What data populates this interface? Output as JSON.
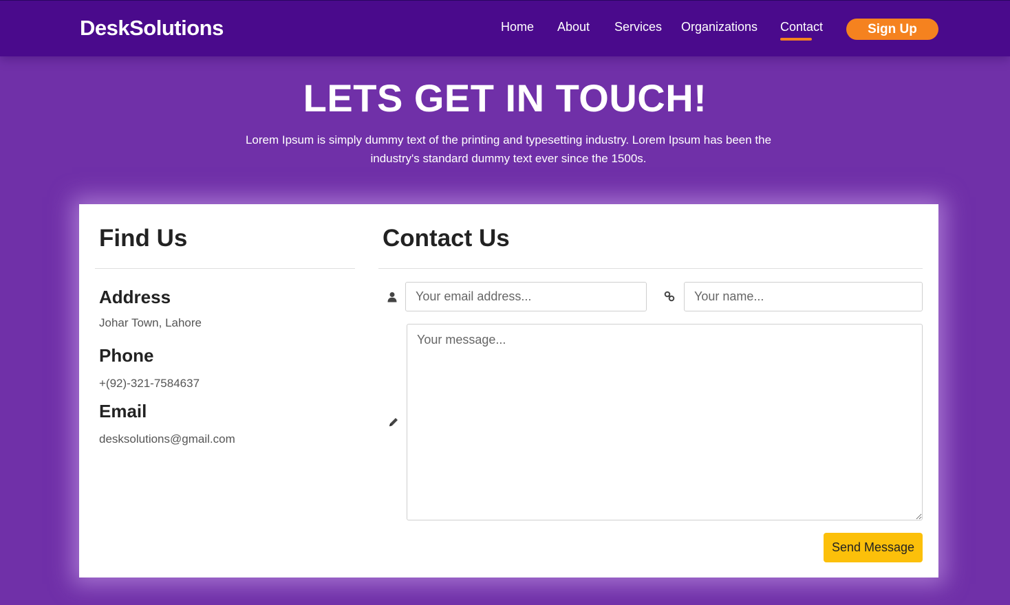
{
  "brand": "DeskSolutions",
  "nav": {
    "items": [
      {
        "label": "Home"
      },
      {
        "label": "About"
      },
      {
        "label": "Services"
      },
      {
        "label": "Organizations"
      },
      {
        "label": "Contact",
        "active": true
      }
    ],
    "signup_label": "Sign Up"
  },
  "hero": {
    "title": "LETS GET IN TOUCH!",
    "line1": "Lorem Ipsum is simply dummy text of the printing and typesetting industry. Lorem Ipsum has been the",
    "line2": "industry's standard dummy text ever since the 1500s."
  },
  "find_us": {
    "title": "Find Us",
    "address_label": "Address",
    "address_value": "Johar Town, Lahore",
    "phone_label": "Phone",
    "phone_value": "+(92)-321-7584637",
    "email_label": "Email",
    "email_value": "desksolutions@gmail.com"
  },
  "contact_us": {
    "title": "Contact Us",
    "email_placeholder": "Your email address...",
    "name_placeholder": "Your name...",
    "message_placeholder": "Your message...",
    "send_label": "Send Message"
  },
  "icons": {
    "email_field": "user-icon",
    "name_field": "link-icon",
    "message_field": "pencil-icon"
  },
  "colors": {
    "navbar": "#4a0a8c",
    "page_background": "#7030a8",
    "accent_orange": "#f5821f",
    "send_button": "#fcc00a"
  }
}
